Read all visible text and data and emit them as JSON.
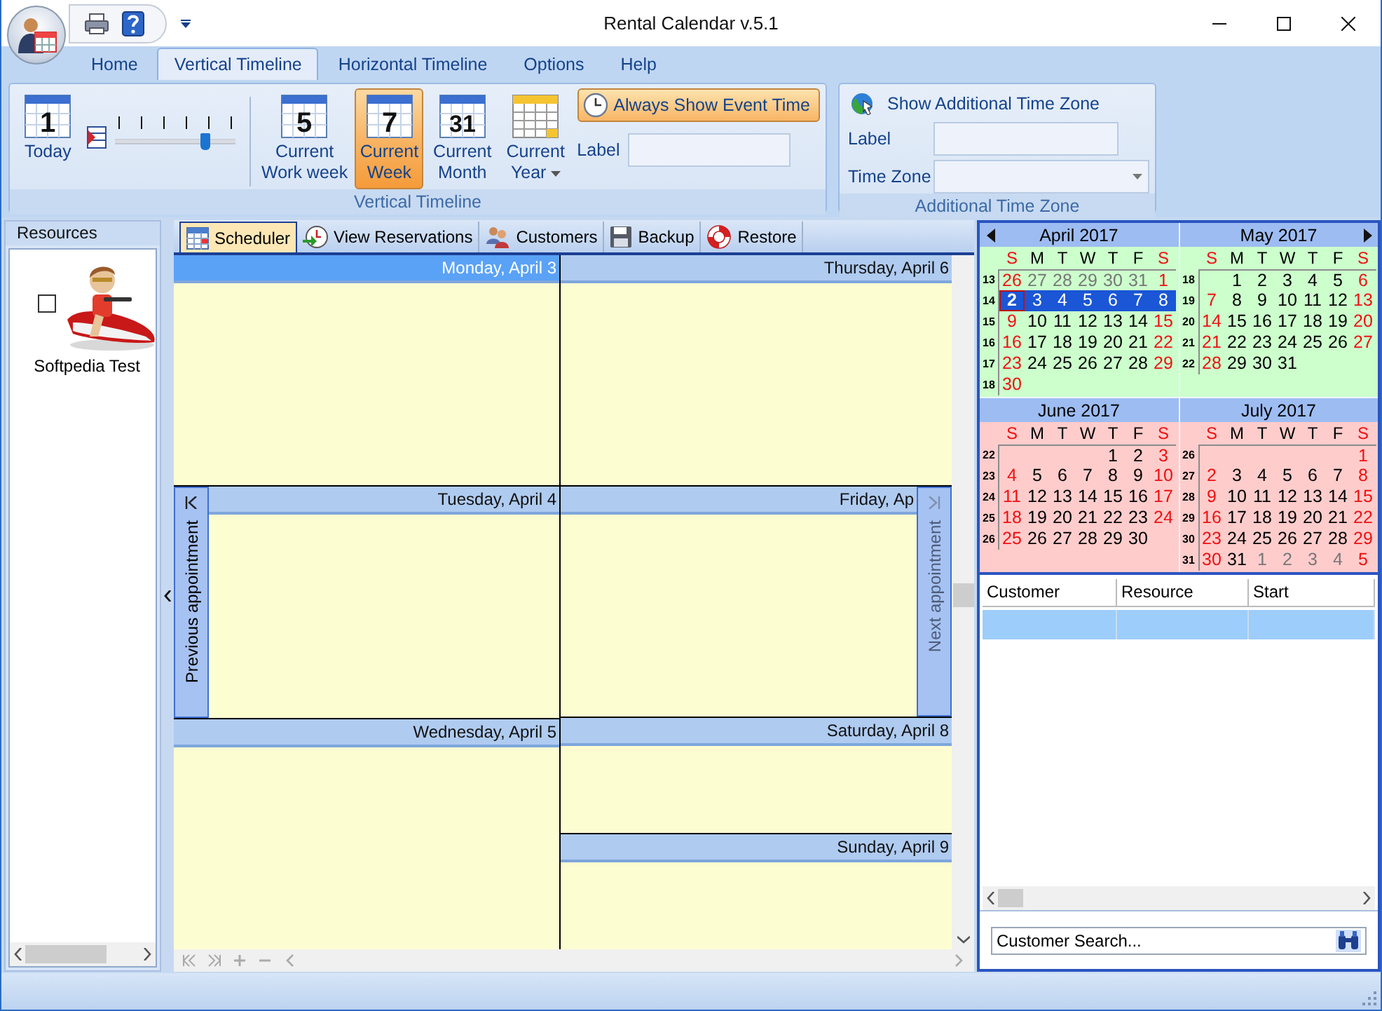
{
  "window": {
    "title": "Rental Calendar v.5.1"
  },
  "ribbon_tabs": [
    {
      "label": "Home",
      "selected": false
    },
    {
      "label": "Vertical Timeline",
      "selected": true
    },
    {
      "label": "Horizontal Timeline",
      "selected": false
    },
    {
      "label": "Options",
      "selected": false
    },
    {
      "label": "Help",
      "selected": false
    }
  ],
  "vertical_timeline_group": {
    "title": "Vertical Timeline",
    "today": {
      "label": "Today",
      "icon_digit": "1"
    },
    "zoom_slider": {
      "level": 0.75
    },
    "view_buttons": [
      {
        "label": "Current\nWork week",
        "icon_digit": "5",
        "selected": false,
        "dropdown": false
      },
      {
        "label": "Current\nWeek",
        "icon_digit": "7",
        "selected": true,
        "dropdown": false
      },
      {
        "label": "Current\nMonth",
        "icon_digit": "31",
        "selected": false,
        "dropdown": false
      },
      {
        "label": "Current\nYear",
        "selected": false,
        "dropdown": true
      }
    ],
    "event_time_button": {
      "label": "Always Show Event Time",
      "on": true
    },
    "label_field": {
      "label": "Label"
    }
  },
  "time_zone_group": {
    "title": "Additional Time Zone",
    "toggle": {
      "label": "Show Additional Time Zone"
    },
    "label_field": {
      "label": "Label"
    },
    "zone_field": {
      "label": "Time Zone"
    }
  },
  "resources": {
    "title": "Resources",
    "items": [
      {
        "name": "Softpedia Test",
        "checked": false
      }
    ]
  },
  "view_tabs": [
    {
      "label": "Scheduler",
      "selected": true
    },
    {
      "label": "View Reservations",
      "selected": false
    },
    {
      "label": "Customers",
      "selected": false
    },
    {
      "label": "Backup",
      "selected": false
    },
    {
      "label": "Restore",
      "selected": false
    }
  ],
  "scheduler": {
    "columns": [
      {
        "days": [
          {
            "label": "Monday, April 3",
            "kind": "full",
            "selected": true
          },
          {
            "label": "Tuesday, April 4",
            "kind": "full",
            "selected": false
          },
          {
            "label": "Wednesday, April 5",
            "kind": "full",
            "selected": false
          }
        ]
      },
      {
        "days": [
          {
            "label": "Thursday, April 6",
            "kind": "full",
            "selected": false
          },
          {
            "label": "Friday, Ap",
            "kind": "full",
            "selected": false
          },
          {
            "label": "Saturday, April 8",
            "kind": "half",
            "selected": false
          },
          {
            "label": "Sunday, April 9",
            "kind": "half",
            "selected": false
          }
        ]
      }
    ],
    "previous_button": {
      "label": "Previous appointment",
      "disabled": false
    },
    "next_button": {
      "label": "Next appointment",
      "disabled": true
    }
  },
  "calendar": {
    "months": [
      {
        "title": "April 2017",
        "color": "#ccffcc",
        "weekdays": [
          "S",
          "M",
          "T",
          "W",
          "T",
          "F",
          "S"
        ],
        "weeks": [
          {
            "number": "13",
            "selected": false,
            "days": [
              {
                "d": "26",
                "kind": "weekend"
              },
              {
                "d": "27",
                "kind": "other"
              },
              {
                "d": "28",
                "kind": "other"
              },
              {
                "d": "29",
                "kind": "other"
              },
              {
                "d": "30",
                "kind": "other"
              },
              {
                "d": "31",
                "kind": "other"
              },
              {
                "d": "1",
                "kind": "weekend"
              }
            ]
          },
          {
            "number": "14",
            "selected": true,
            "days": [
              {
                "d": "2",
                "kind": "today"
              },
              {
                "d": "3",
                "kind": "day"
              },
              {
                "d": "4",
                "kind": "day"
              },
              {
                "d": "5",
                "kind": "day"
              },
              {
                "d": "6",
                "kind": "day"
              },
              {
                "d": "7",
                "kind": "day"
              },
              {
                "d": "8",
                "kind": "weekend"
              }
            ]
          },
          {
            "number": "15",
            "selected": false,
            "days": [
              {
                "d": "9",
                "kind": "weekend"
              },
              {
                "d": "10",
                "kind": "day"
              },
              {
                "d": "11",
                "kind": "day"
              },
              {
                "d": "12",
                "kind": "day"
              },
              {
                "d": "13",
                "kind": "day"
              },
              {
                "d": "14",
                "kind": "day"
              },
              {
                "d": "15",
                "kind": "weekend"
              }
            ]
          },
          {
            "number": "16",
            "selected": false,
            "days": [
              {
                "d": "16",
                "kind": "weekend"
              },
              {
                "d": "17",
                "kind": "day"
              },
              {
                "d": "18",
                "kind": "day"
              },
              {
                "d": "19",
                "kind": "day"
              },
              {
                "d": "20",
                "kind": "day"
              },
              {
                "d": "21",
                "kind": "day"
              },
              {
                "d": "22",
                "kind": "weekend"
              }
            ]
          },
          {
            "number": "17",
            "selected": false,
            "days": [
              {
                "d": "23",
                "kind": "weekend"
              },
              {
                "d": "24",
                "kind": "day"
              },
              {
                "d": "25",
                "kind": "day"
              },
              {
                "d": "26",
                "kind": "day"
              },
              {
                "d": "27",
                "kind": "day"
              },
              {
                "d": "28",
                "kind": "day"
              },
              {
                "d": "29",
                "kind": "weekend"
              }
            ]
          },
          {
            "number": "18",
            "selected": false,
            "days": [
              {
                "d": "30",
                "kind": "weekend"
              }
            ]
          }
        ]
      },
      {
        "title": "May 2017",
        "color": "#ccffcc",
        "weekdays": [
          "S",
          "M",
          "T",
          "W",
          "T",
          "F",
          "S"
        ],
        "weeks": [
          {
            "number": "18",
            "selected": false,
            "days": [
              {
                "kind": "blank"
              },
              {
                "d": "1",
                "kind": "day"
              },
              {
                "d": "2",
                "kind": "day"
              },
              {
                "d": "3",
                "kind": "day"
              },
              {
                "d": "4",
                "kind": "day"
              },
              {
                "d": "5",
                "kind": "day"
              },
              {
                "d": "6",
                "kind": "weekend"
              }
            ]
          },
          {
            "number": "19",
            "selected": false,
            "days": [
              {
                "d": "7",
                "kind": "weekend"
              },
              {
                "d": "8",
                "kind": "day"
              },
              {
                "d": "9",
                "kind": "day"
              },
              {
                "d": "10",
                "kind": "day"
              },
              {
                "d": "11",
                "kind": "day"
              },
              {
                "d": "12",
                "kind": "day"
              },
              {
                "d": "13",
                "kind": "weekend"
              }
            ]
          },
          {
            "number": "20",
            "selected": false,
            "days": [
              {
                "d": "14",
                "kind": "weekend"
              },
              {
                "d": "15",
                "kind": "day"
              },
              {
                "d": "16",
                "kind": "day"
              },
              {
                "d": "17",
                "kind": "day"
              },
              {
                "d": "18",
                "kind": "day"
              },
              {
                "d": "19",
                "kind": "day"
              },
              {
                "d": "20",
                "kind": "weekend"
              }
            ]
          },
          {
            "number": "21",
            "selected": false,
            "days": [
              {
                "d": "21",
                "kind": "weekend"
              },
              {
                "d": "22",
                "kind": "day"
              },
              {
                "d": "23",
                "kind": "day"
              },
              {
                "d": "24",
                "kind": "day"
              },
              {
                "d": "25",
                "kind": "day"
              },
              {
                "d": "26",
                "kind": "day"
              },
              {
                "d": "27",
                "kind": "weekend"
              }
            ]
          },
          {
            "number": "22",
            "selected": false,
            "days": [
              {
                "d": "28",
                "kind": "weekend"
              },
              {
                "d": "29",
                "kind": "day"
              },
              {
                "d": "30",
                "kind": "day"
              },
              {
                "d": "31",
                "kind": "day"
              }
            ]
          }
        ]
      },
      {
        "title": "June 2017",
        "color": "#ffcccc",
        "weekdays": [
          "S",
          "M",
          "T",
          "W",
          "T",
          "F",
          "S"
        ],
        "weeks": [
          {
            "number": "22",
            "selected": false,
            "days": [
              {
                "kind": "blank"
              },
              {
                "kind": "blank"
              },
              {
                "kind": "blank"
              },
              {
                "kind": "blank"
              },
              {
                "d": "1",
                "kind": "day"
              },
              {
                "d": "2",
                "kind": "day"
              },
              {
                "d": "3",
                "kind": "weekend"
              }
            ]
          },
          {
            "number": "23",
            "selected": false,
            "days": [
              {
                "d": "4",
                "kind": "weekend"
              },
              {
                "d": "5",
                "kind": "day"
              },
              {
                "d": "6",
                "kind": "day"
              },
              {
                "d": "7",
                "kind": "day"
              },
              {
                "d": "8",
                "kind": "day"
              },
              {
                "d": "9",
                "kind": "day"
              },
              {
                "d": "10",
                "kind": "weekend"
              }
            ]
          },
          {
            "number": "24",
            "selected": false,
            "days": [
              {
                "d": "11",
                "kind": "weekend"
              },
              {
                "d": "12",
                "kind": "day"
              },
              {
                "d": "13",
                "kind": "day"
              },
              {
                "d": "14",
                "kind": "day"
              },
              {
                "d": "15",
                "kind": "day"
              },
              {
                "d": "16",
                "kind": "day"
              },
              {
                "d": "17",
                "kind": "weekend"
              }
            ]
          },
          {
            "number": "25",
            "selected": false,
            "days": [
              {
                "d": "18",
                "kind": "weekend"
              },
              {
                "d": "19",
                "kind": "day"
              },
              {
                "d": "20",
                "kind": "day"
              },
              {
                "d": "21",
                "kind": "day"
              },
              {
                "d": "22",
                "kind": "day"
              },
              {
                "d": "23",
                "kind": "day"
              },
              {
                "d": "24",
                "kind": "weekend"
              }
            ]
          },
          {
            "number": "26",
            "selected": false,
            "days": [
              {
                "d": "25",
                "kind": "weekend"
              },
              {
                "d": "26",
                "kind": "day"
              },
              {
                "d": "27",
                "kind": "day"
              },
              {
                "d": "28",
                "kind": "day"
              },
              {
                "d": "29",
                "kind": "day"
              },
              {
                "d": "30",
                "kind": "day"
              }
            ]
          }
        ]
      },
      {
        "title": "July 2017",
        "color": "#ffcccc",
        "weekdays": [
          "S",
          "M",
          "T",
          "W",
          "T",
          "F",
          "S"
        ],
        "weeks": [
          {
            "number": "26",
            "selected": false,
            "days": [
              {
                "kind": "blank"
              },
              {
                "kind": "blank"
              },
              {
                "kind": "blank"
              },
              {
                "kind": "blank"
              },
              {
                "kind": "blank"
              },
              {
                "kind": "blank"
              },
              {
                "d": "1",
                "kind": "weekend"
              }
            ]
          },
          {
            "number": "27",
            "selected": false,
            "days": [
              {
                "d": "2",
                "kind": "weekend"
              },
              {
                "d": "3",
                "kind": "day"
              },
              {
                "d": "4",
                "kind": "day"
              },
              {
                "d": "5",
                "kind": "day"
              },
              {
                "d": "6",
                "kind": "day"
              },
              {
                "d": "7",
                "kind": "day"
              },
              {
                "d": "8",
                "kind": "weekend"
              }
            ]
          },
          {
            "number": "28",
            "selected": false,
            "days": [
              {
                "d": "9",
                "kind": "weekend"
              },
              {
                "d": "10",
                "kind": "day"
              },
              {
                "d": "11",
                "kind": "day"
              },
              {
                "d": "12",
                "kind": "day"
              },
              {
                "d": "13",
                "kind": "day"
              },
              {
                "d": "14",
                "kind": "day"
              },
              {
                "d": "15",
                "kind": "weekend"
              }
            ]
          },
          {
            "number": "29",
            "selected": false,
            "days": [
              {
                "d": "16",
                "kind": "weekend"
              },
              {
                "d": "17",
                "kind": "day"
              },
              {
                "d": "18",
                "kind": "day"
              },
              {
                "d": "19",
                "kind": "day"
              },
              {
                "d": "20",
                "kind": "day"
              },
              {
                "d": "21",
                "kind": "day"
              },
              {
                "d": "22",
                "kind": "weekend"
              }
            ]
          },
          {
            "number": "30",
            "selected": false,
            "days": [
              {
                "d": "23",
                "kind": "weekend"
              },
              {
                "d": "24",
                "kind": "day"
              },
              {
                "d": "25",
                "kind": "day"
              },
              {
                "d": "26",
                "kind": "day"
              },
              {
                "d": "27",
                "kind": "day"
              },
              {
                "d": "28",
                "kind": "day"
              },
              {
                "d": "29",
                "kind": "weekend"
              }
            ]
          },
          {
            "number": "31",
            "selected": false,
            "days": [
              {
                "d": "30",
                "kind": "weekend"
              },
              {
                "d": "31",
                "kind": "day"
              },
              {
                "d": "1",
                "kind": "other"
              },
              {
                "d": "2",
                "kind": "other"
              },
              {
                "d": "3",
                "kind": "other"
              },
              {
                "d": "4",
                "kind": "other"
              },
              {
                "d": "5",
                "kind": "weekend"
              }
            ]
          }
        ]
      }
    ]
  },
  "customer_grid": {
    "columns": [
      "Customer",
      "Resource",
      "Start"
    ],
    "rows": [
      {
        "selected": true
      }
    ]
  },
  "customer_search": {
    "value": "Customer Search..."
  }
}
